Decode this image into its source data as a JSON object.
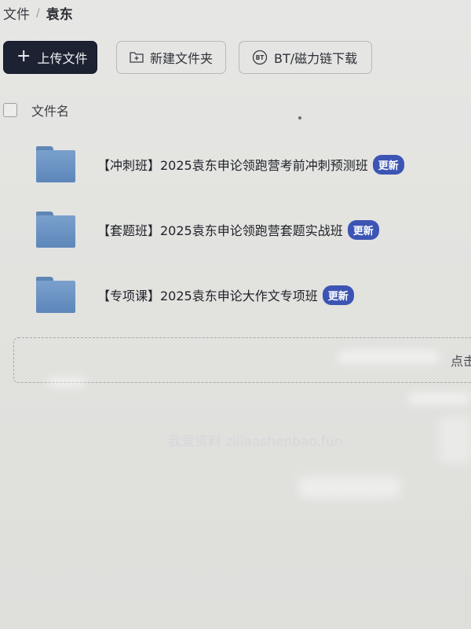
{
  "breadcrumb": {
    "root": "文件",
    "separator": "/",
    "current": "袁东"
  },
  "toolbar": {
    "upload_label": "上传文件",
    "new_folder_label": "新建文件夹",
    "bt_label": "BT/磁力链下载"
  },
  "list_header": {
    "name_column": "文件名"
  },
  "files": [
    {
      "name": "【冲刺班】2025袁东申论领跑营考前冲刺预测班",
      "badge": "更新"
    },
    {
      "name": "【套题班】2025袁东申论领跑营套题实战班",
      "badge": "更新"
    },
    {
      "name": "【专项课】2025袁东申论大作文专项班",
      "badge": "更新"
    }
  ],
  "drop_zone": {
    "hint": "点击"
  },
  "watermark": {
    "text": "我爱资料 ziliaoshenbao.fun"
  },
  "colors": {
    "primary_button": "#1d2233",
    "badge": "#3c55b4",
    "folder": "#6a92c3"
  },
  "icons": {
    "upload": "plus-icon",
    "new_folder": "folder-plus-icon",
    "bt": "bt-icon",
    "folder": "folder-icon"
  }
}
